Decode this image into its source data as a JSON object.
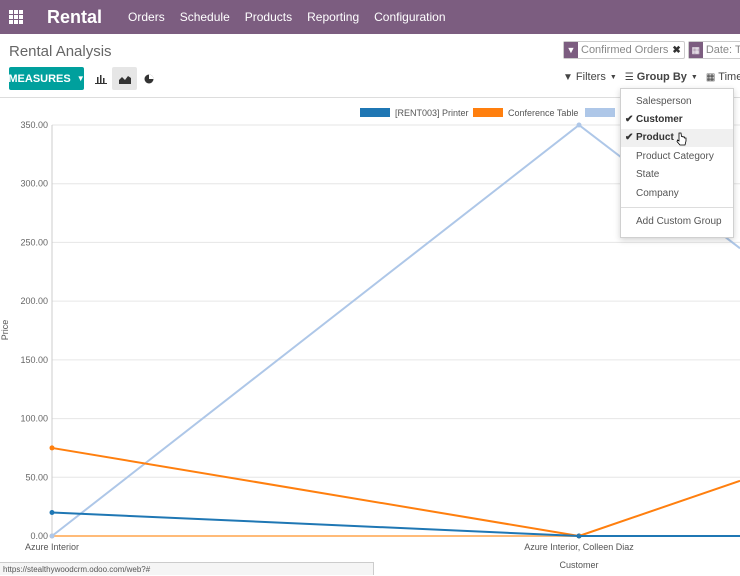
{
  "app": {
    "name": "Rental",
    "menu": [
      "Orders",
      "Schedule",
      "Products",
      "Reporting",
      "Configuration"
    ]
  },
  "page": {
    "title": "Rental Analysis"
  },
  "search": {
    "facets": [
      {
        "icon": "filter-icon",
        "label": "Confirmed Orders"
      },
      {
        "icon": "calendar-icon",
        "label": "Date: This Y"
      }
    ],
    "filters_label": "Filters",
    "groupby_label": "Group By",
    "timerange_label": "Time Ran"
  },
  "toolbar": {
    "measures_label": "MEASURES",
    "views": [
      "bar-chart-icon",
      "line-chart-icon",
      "pie-chart-icon"
    ],
    "active_view": "line-chart-icon"
  },
  "groupby_menu": {
    "items": [
      {
        "label": "Salesperson",
        "checked": false
      },
      {
        "label": "Customer",
        "checked": true
      },
      {
        "label": "Product",
        "checked": true
      },
      {
        "label": "Product Category",
        "checked": false
      },
      {
        "label": "State",
        "checked": false
      },
      {
        "label": "Company",
        "checked": false
      }
    ],
    "custom_label": "Add Custom Group"
  },
  "chart_data": {
    "type": "line",
    "xlabel": "Customer",
    "ylabel": "Price",
    "ylim": [
      0,
      350
    ],
    "yticks": [
      "0.00",
      "50.00",
      "100.00",
      "150.00",
      "200.00",
      "250.00",
      "300.00",
      "350.00"
    ],
    "categories": [
      "Azure Interior",
      "Azure Interior, Colleen Diaz"
    ],
    "series": [
      {
        "name": "[RENT003] Printer",
        "color": "#1f77b4",
        "values": [
          20,
          0
        ]
      },
      {
        "name": "Conference Table",
        "color": "#ff7f0e",
        "values": [
          75,
          0
        ]
      },
      {
        "name": "",
        "color": "#aec7e8",
        "values": [
          0,
          350
        ]
      },
      {
        "name": "",
        "color": "#ffbb78",
        "values": [
          0,
          0
        ]
      }
    ]
  },
  "status_bar": {
    "url": "https://stealthywoodcrm.odoo.com/web?#"
  },
  "colors": {
    "brand": "#7c5d80",
    "primary_button": "#00a09d"
  }
}
